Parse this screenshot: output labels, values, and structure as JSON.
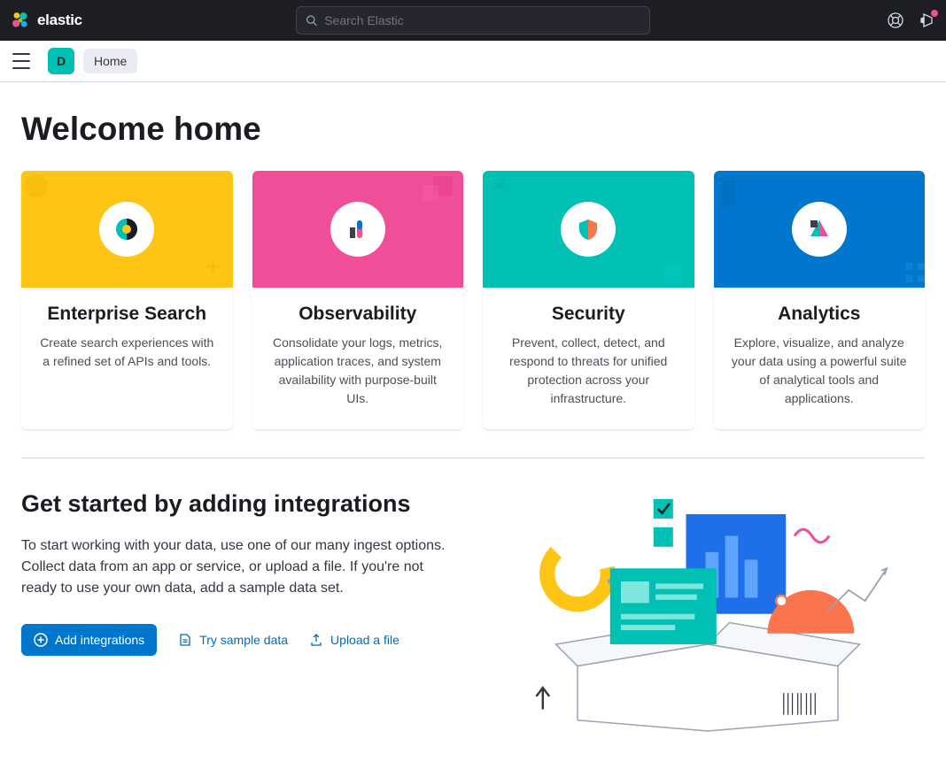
{
  "header": {
    "brand": "elastic",
    "search_placeholder": "Search Elastic"
  },
  "subheader": {
    "space_letter": "D",
    "breadcrumb": "Home"
  },
  "main": {
    "title": "Welcome home",
    "cards": [
      {
        "title": "Enterprise Search",
        "desc": "Create search experiences with a refined set of APIs and tools."
      },
      {
        "title": "Observability",
        "desc": "Consolidate your logs, metrics, application traces, and system availability with purpose-built UIs."
      },
      {
        "title": "Security",
        "desc": "Prevent, collect, detect, and respond to threats for unified protection across your infrastructure."
      },
      {
        "title": "Analytics",
        "desc": "Explore, visualize, and analyze your data using a powerful suite of analytical tools and applications."
      }
    ]
  },
  "get_started": {
    "title": "Get started by adding integrations",
    "desc": "To start working with your data, use one of our many ingest options. Collect data from an app or service, or upload a file. If you're not ready to use your own data, add a sample data set.",
    "add_btn": "Add integrations",
    "sample_btn": "Try sample data",
    "upload_btn": "Upload a file"
  },
  "colors": {
    "yellow": "#fec514",
    "pink": "#f04e98",
    "teal": "#00bfb3",
    "blue": "#0077cc"
  }
}
